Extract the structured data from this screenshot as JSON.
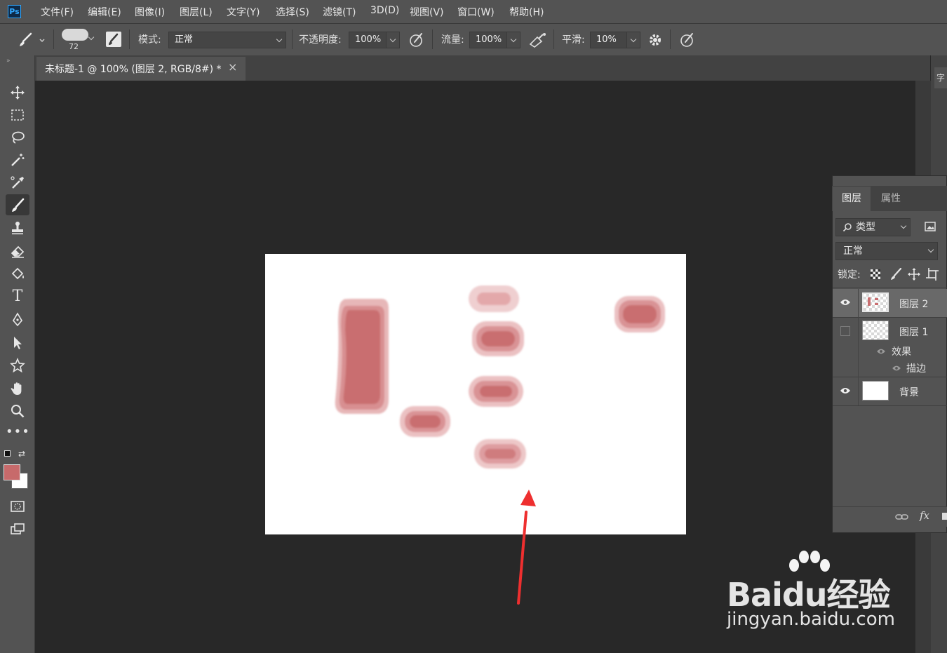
{
  "app": {
    "logo_text": "Ps"
  },
  "menu": [
    "文件(F)",
    "编辑(E)",
    "图像(I)",
    "图层(L)",
    "文字(Y)",
    "选择(S)",
    "滤镜(T)",
    "3D(D)",
    "视图(V)",
    "窗口(W)",
    "帮助(H)"
  ],
  "options": {
    "brush_size": "72",
    "mode_label": "模式:",
    "mode_value": "正常",
    "opacity_label": "不透明度:",
    "opacity_value": "100%",
    "flow_label": "流量:",
    "flow_value": "100%",
    "smoothing_label": "平滑:",
    "smoothing_value": "10%"
  },
  "document": {
    "tab_title": "未标题-1 @ 100% (图层 2, RGB/8#) *",
    "close_glyph": "×"
  },
  "colors": {
    "foreground": "#c76a6b",
    "background": "#ffffff",
    "stroke": "#c96e70",
    "annotation_arrow": "#ee2f2f"
  },
  "layers_panel": {
    "tabs": [
      "图层",
      "属性"
    ],
    "filter_value": "类型",
    "blend_value": "正常",
    "lock_label": "锁定:",
    "layers": [
      {
        "name": "图层 2",
        "visible": true,
        "selected": true
      },
      {
        "name": "图层 1",
        "visible": false,
        "selected": false
      },
      {
        "name": "背景",
        "visible": true,
        "selected": false
      }
    ],
    "effects_label": "效果",
    "stroke_effect_label": "描边",
    "footer_fx": "fx"
  },
  "right_dock": {
    "collapsed_label": "字"
  },
  "watermark": {
    "brand": "Baidu经验",
    "url": "jingyan.baidu.com"
  }
}
